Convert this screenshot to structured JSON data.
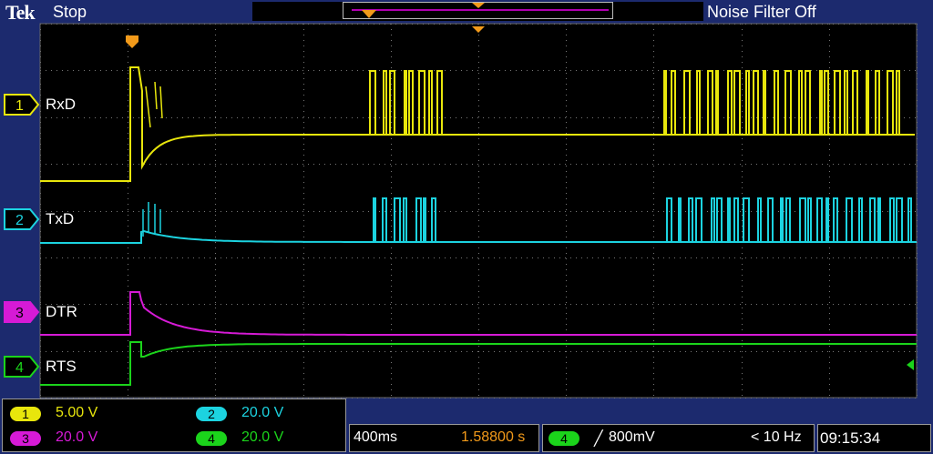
{
  "header": {
    "brand": "Tek",
    "run_state": "Stop",
    "noise_filter": "Noise Filter Off"
  },
  "channels": [
    {
      "number": "1",
      "name": "RxD",
      "color": "#e8e60c",
      "scale": "5.00 V"
    },
    {
      "number": "2",
      "name": "TxD",
      "color": "#1cd3e0",
      "scale": "20.0 V"
    },
    {
      "number": "3",
      "name": "DTR",
      "color": "#d61ad6",
      "scale": "20.0 V"
    },
    {
      "number": "4",
      "name": "RTS",
      "color": "#1bd41b",
      "scale": "20.0 V"
    }
  ],
  "timebase": {
    "scale": "400ms",
    "position": "1.58800 s"
  },
  "trigger": {
    "source": "4",
    "slope": "╱",
    "level": "800mV",
    "frequency": "< 10 Hz"
  },
  "clock": "09:15:34",
  "markers": {
    "trigger_marker": "T"
  }
}
